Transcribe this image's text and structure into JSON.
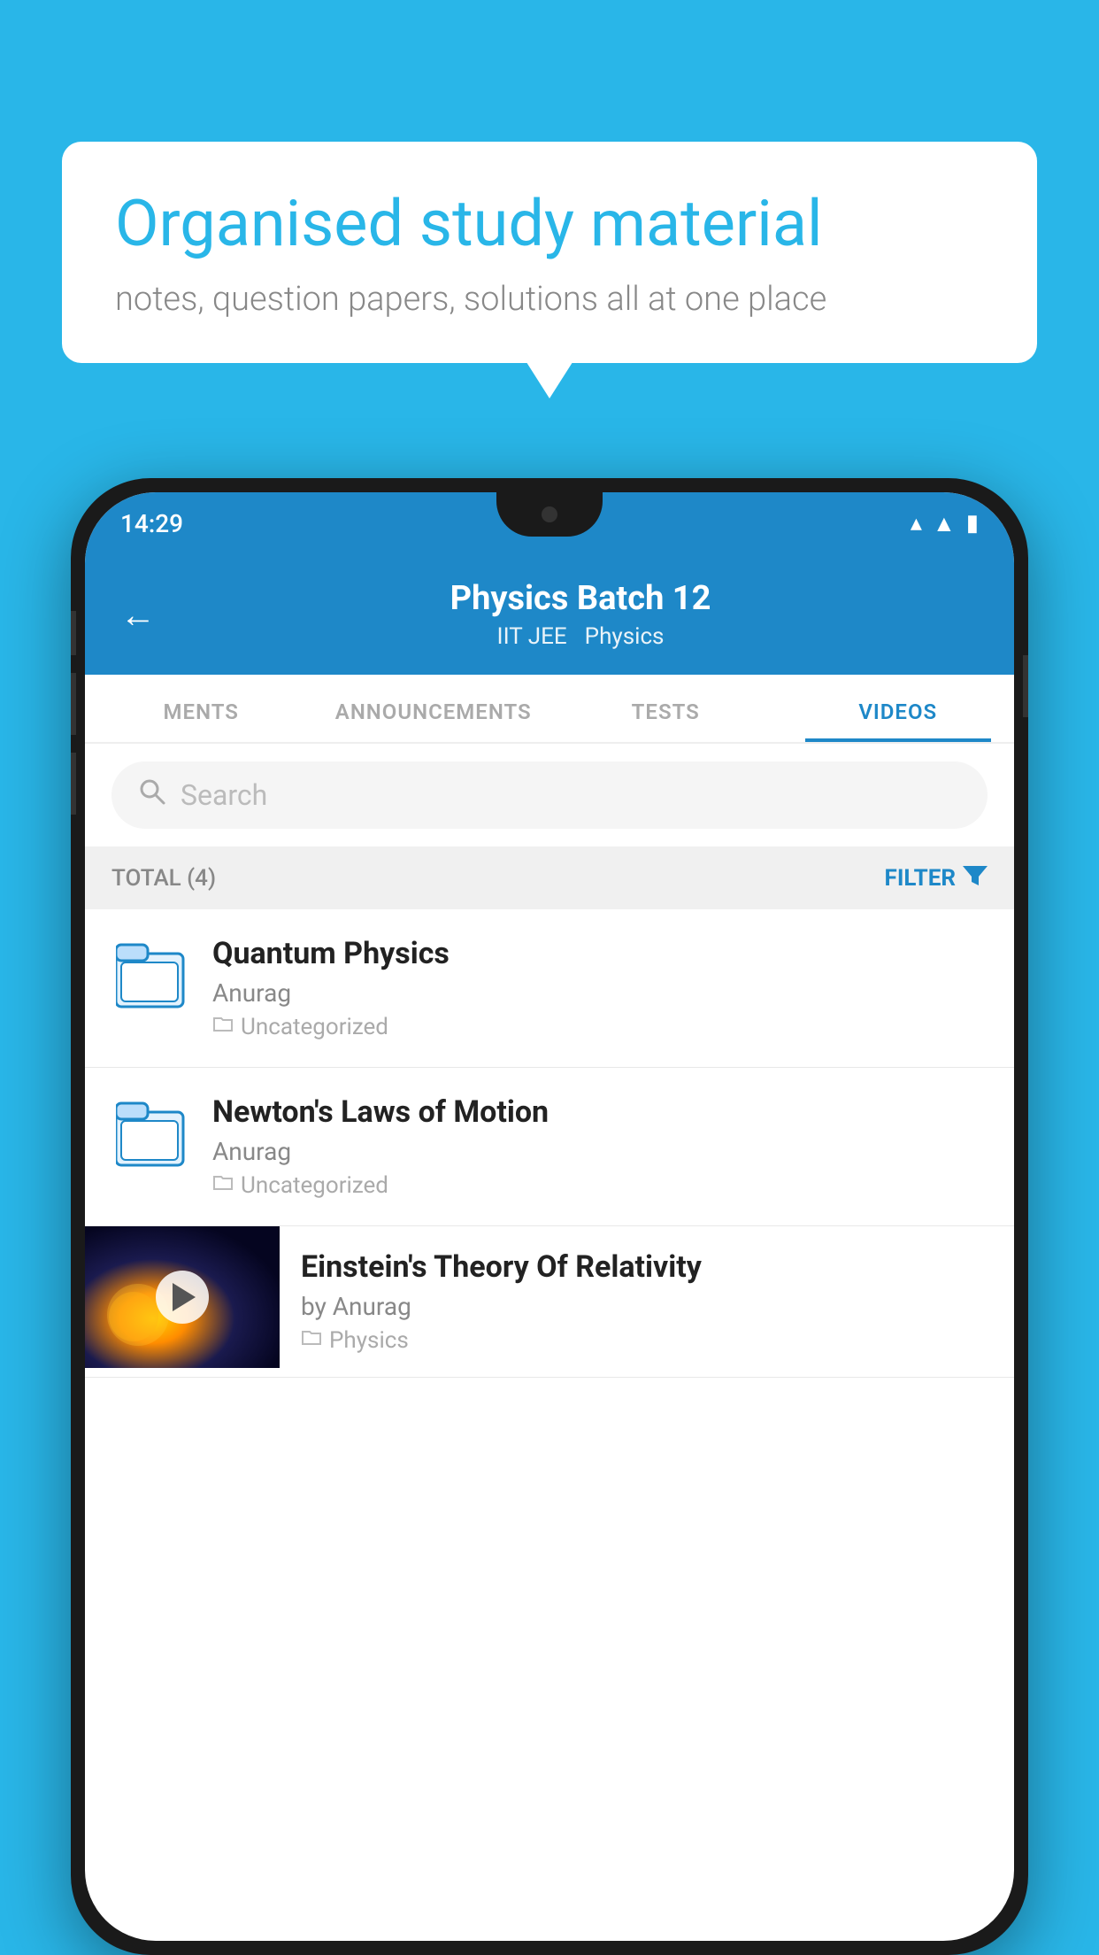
{
  "background_color": "#29b6e8",
  "bubble": {
    "title": "Organised study material",
    "subtitle": "notes, question papers, solutions all at one place"
  },
  "phone": {
    "status_bar": {
      "time": "14:29"
    },
    "header": {
      "back_label": "←",
      "title": "Physics Batch 12",
      "tag1": "IIT JEE",
      "tag2": "Physics"
    },
    "tabs": [
      {
        "label": "MENTS",
        "active": false
      },
      {
        "label": "ANNOUNCEMENTS",
        "active": false
      },
      {
        "label": "TESTS",
        "active": false
      },
      {
        "label": "VIDEOS",
        "active": true
      }
    ],
    "search": {
      "placeholder": "Search"
    },
    "filter_bar": {
      "total_label": "TOTAL (4)",
      "filter_label": "FILTER"
    },
    "videos": [
      {
        "title": "Quantum Physics",
        "author": "Anurag",
        "tag": "Uncategorized",
        "has_thumb": false
      },
      {
        "title": "Newton's Laws of Motion",
        "author": "Anurag",
        "tag": "Uncategorized",
        "has_thumb": false
      },
      {
        "title": "Einstein's Theory Of Relativity",
        "author": "by Anurag",
        "tag": "Physics",
        "has_thumb": true
      }
    ]
  }
}
